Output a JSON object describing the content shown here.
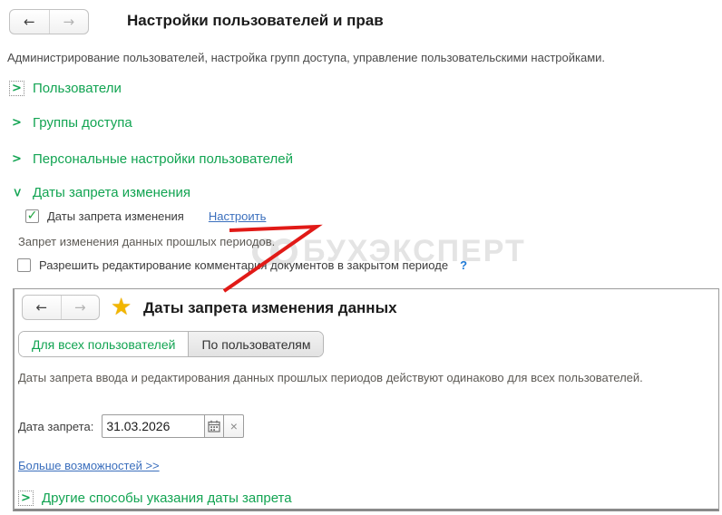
{
  "icons": {
    "back": "←",
    "forward": "→",
    "chevron": ">",
    "check": "✓",
    "star": "★",
    "clear": "×",
    "help": "?"
  },
  "main_window": {
    "title": "Настройки пользователей и прав",
    "subtitle": "Администрирование пользователей, настройка групп доступа, управление пользовательскими настройками.",
    "sections": [
      {
        "label": "Пользователи",
        "expanded": false
      },
      {
        "label": "Группы доступа",
        "expanded": false
      },
      {
        "label": "Персональные настройки пользователей",
        "expanded": false
      },
      {
        "label": "Даты запрета изменения",
        "expanded": true
      }
    ],
    "dates_block": {
      "checkbox_label": "Даты запрета изменения",
      "checkbox_checked": true,
      "configure_link": "Настроить",
      "hint": "Запрет изменения данных прошлых периодов.",
      "comment_checkbox_label": "Разрешить редактирование комментария документов в закрытом периоде",
      "comment_checkbox_checked": false
    }
  },
  "watermark": {
    "text": "БУХЭКСПЕРТ"
  },
  "dialog": {
    "title": "Даты запрета изменения данных",
    "tabs": [
      {
        "label": "Для всех пользователей",
        "active": true
      },
      {
        "label": "По пользователям",
        "active": false
      }
    ],
    "description": "Даты запрета ввода и редактирования данных прошлых периодов действуют одинаково для всех пользователей.",
    "date_label": "Дата запрета:",
    "date_value": "31.03.2026",
    "more_link": "Больше возможностей >>",
    "other_ways_section": "Другие способы указания даты запрета"
  }
}
